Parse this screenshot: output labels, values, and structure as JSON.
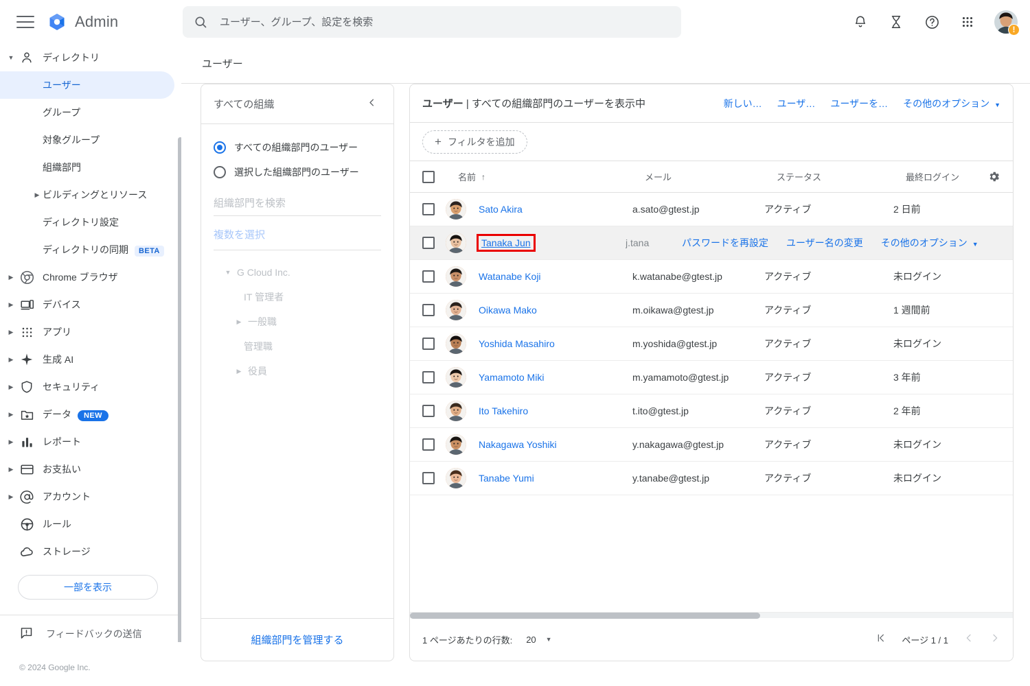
{
  "app": {
    "brand": "Admin",
    "menu_icon": "hamburger-icon",
    "copyright": "© 2024 Google Inc."
  },
  "search": {
    "placeholder": "ユーザー、グループ、設定を検索",
    "value": ""
  },
  "topicons": [
    {
      "name": "notifications-icon",
      "label": "通知"
    },
    {
      "name": "hourglass-icon",
      "label": "試用期間"
    },
    {
      "name": "help-icon",
      "label": "ヘルプ"
    },
    {
      "name": "apps-grid-icon",
      "label": "アプリ"
    },
    {
      "name": "avatar-icon",
      "label": "アカウント"
    }
  ],
  "content_tab": {
    "label": "ユーザー"
  },
  "sidebar": {
    "items": [
      {
        "label": "ディレクトリ",
        "icon": "person-icon",
        "caret": true,
        "level": 0,
        "active": false
      },
      {
        "label": "ユーザー",
        "icon": "",
        "caret": false,
        "level": 1,
        "active": true
      },
      {
        "label": "グループ",
        "icon": "",
        "caret": false,
        "level": 1,
        "active": false
      },
      {
        "label": "対象グループ",
        "icon": "",
        "caret": false,
        "level": 1,
        "active": false
      },
      {
        "label": "組織部門",
        "icon": "",
        "caret": false,
        "level": 1,
        "active": false
      },
      {
        "label": "ビルディングとリソース",
        "icon": "",
        "caret": true,
        "level": 1,
        "active": false
      },
      {
        "label": "ディレクトリ設定",
        "icon": "",
        "caret": false,
        "level": 1,
        "active": false
      },
      {
        "label": "ディレクトリの同期",
        "icon": "",
        "caret": false,
        "level": 1,
        "active": false,
        "badge": "BETA",
        "badge_type": "beta"
      },
      {
        "label": "Chrome ブラウザ",
        "icon": "chrome-icon",
        "caret": true,
        "level": 0,
        "active": false
      },
      {
        "label": "デバイス",
        "icon": "devices-icon",
        "caret": true,
        "level": 0,
        "active": false
      },
      {
        "label": "アプリ",
        "icon": "apps-icon",
        "caret": true,
        "level": 0,
        "active": false
      },
      {
        "label": "生成 AI",
        "icon": "sparkle-icon",
        "caret": true,
        "level": 0,
        "active": false
      },
      {
        "label": "セキュリティ",
        "icon": "shield-icon",
        "caret": true,
        "level": 0,
        "active": false
      },
      {
        "label": "データ",
        "icon": "folder-star-icon",
        "caret": true,
        "level": 0,
        "active": false,
        "badge": "NEW",
        "badge_type": "new"
      },
      {
        "label": "レポート",
        "icon": "bar-chart-icon",
        "caret": true,
        "level": 0,
        "active": false
      },
      {
        "label": "お支払い",
        "icon": "credit-card-icon",
        "caret": true,
        "level": 0,
        "active": false
      },
      {
        "label": "アカウント",
        "icon": "at-sign-icon",
        "caret": true,
        "level": 0,
        "active": false
      },
      {
        "label": "ルール",
        "icon": "steering-wheel-icon",
        "caret": false,
        "level": 0,
        "active": false
      },
      {
        "label": "ストレージ",
        "icon": "cloud-icon",
        "caret": false,
        "level": 0,
        "active": false
      }
    ],
    "show_more": "一部を表示",
    "feedback": "フィードバックの送信"
  },
  "org_panel": {
    "title": "すべての組織",
    "collapse_icon": "chevron-left-icon",
    "radios": [
      {
        "label": "すべての組織部門のユーザー",
        "selected": true
      },
      {
        "label": "選択した組織部門のユーザー",
        "selected": false
      }
    ],
    "search_placeholder": "組織部門を検索",
    "multi_select": "複数を選択",
    "tree": [
      {
        "label": "G Cloud Inc.",
        "level": 0,
        "caret": "down"
      },
      {
        "label": "IT 管理者",
        "level": 1,
        "caret": "none"
      },
      {
        "label": "一般職",
        "level": 1,
        "caret": "right"
      },
      {
        "label": "管理職",
        "level": 1,
        "caret": "none"
      },
      {
        "label": "役員",
        "level": 1,
        "caret": "right"
      }
    ],
    "footer_link": "組織部門を管理する"
  },
  "table": {
    "title_bold": "ユーザー",
    "title_rest": " | すべての組織部門のユーザーを表示中",
    "actions": [
      {
        "label": "新しい…"
      },
      {
        "label": "ユーザ…"
      },
      {
        "label": "ユーザーを…"
      },
      {
        "label": "その他のオプション",
        "caret": true
      }
    ],
    "filter_label": "フィルタを追加",
    "columns": {
      "name": "名前",
      "sort_arrow": "↑",
      "email": "メール",
      "status": "ステータス",
      "last_login": "最終ログイン",
      "settings_icon": "gear-icon"
    },
    "rows": [
      {
        "name": "Sato Akira",
        "email": "a.sato@gtest.jp",
        "status": "アクティブ",
        "last_login": "2 日前",
        "selected": false,
        "hover": false,
        "skin": "#d9a06f",
        "hair": "#2b2320"
      },
      {
        "name": "Tanaka Jun",
        "email": "j.tana",
        "status": "",
        "last_login": "",
        "selected": true,
        "hover": true,
        "skin": "#e8c0a0",
        "hair": "#17120f"
      },
      {
        "name": "Watanabe Koji",
        "email": "k.watanabe@gtest.jp",
        "status": "アクティブ",
        "last_login": "未ログイン",
        "selected": false,
        "hover": false,
        "skin": "#c99069",
        "hair": "#1f1a17"
      },
      {
        "name": "Oikawa Mako",
        "email": "m.oikawa@gtest.jp",
        "status": "アクティブ",
        "last_login": "1 週間前",
        "selected": false,
        "hover": false,
        "skin": "#e3b394",
        "hair": "#2a211c"
      },
      {
        "name": "Yoshida Masahiro",
        "email": "m.yoshida@gtest.jp",
        "status": "アクティブ",
        "last_login": "未ログイン",
        "selected": false,
        "hover": false,
        "skin": "#b87f55",
        "hair": "#140f0d"
      },
      {
        "name": "Yamamoto Miki",
        "email": "m.yamamoto@gtest.jp",
        "status": "アクティブ",
        "last_login": "3 年前",
        "selected": false,
        "hover": false,
        "skin": "#edc9ab",
        "hair": "#1b1512"
      },
      {
        "name": "Ito Takehiro",
        "email": "t.ito@gtest.jp",
        "status": "アクティブ",
        "last_login": "2 年前",
        "selected": false,
        "hover": false,
        "skin": "#e0ae87",
        "hair": "#3a2a1e"
      },
      {
        "name": "Nakagawa Yoshiki",
        "email": "y.nakagawa@gtest.jp",
        "status": "アクティブ",
        "last_login": "未ログイン",
        "selected": false,
        "hover": false,
        "skin": "#c98f62",
        "hair": "#191411"
      },
      {
        "name": "Tanabe Yumi",
        "email": "y.tanabe@gtest.jp",
        "status": "アクティブ",
        "last_login": "未ログイン",
        "selected": false,
        "hover": false,
        "skin": "#edbb9a",
        "hair": "#4a2e1c"
      }
    ],
    "row_actions": [
      {
        "label": "パスワードを再設定"
      },
      {
        "label": "ユーザー名の変更"
      },
      {
        "label": "その他のオプション",
        "caret": true
      }
    ],
    "footer": {
      "rows_per_page_label": "1 ページあたりの行数:",
      "rows_per_page_value": "20",
      "page_label": "ページ 1 / 1",
      "first_icon": "first-page-icon",
      "prev_icon": "prev-page-icon",
      "next_icon": "next-page-icon"
    }
  },
  "colors": {
    "accent": "#1a73e8",
    "active_bg": "#e8f0fe",
    "selection_outline": "#ea0000",
    "badge_new": "#1a73e8",
    "warn": "#f9a825"
  }
}
